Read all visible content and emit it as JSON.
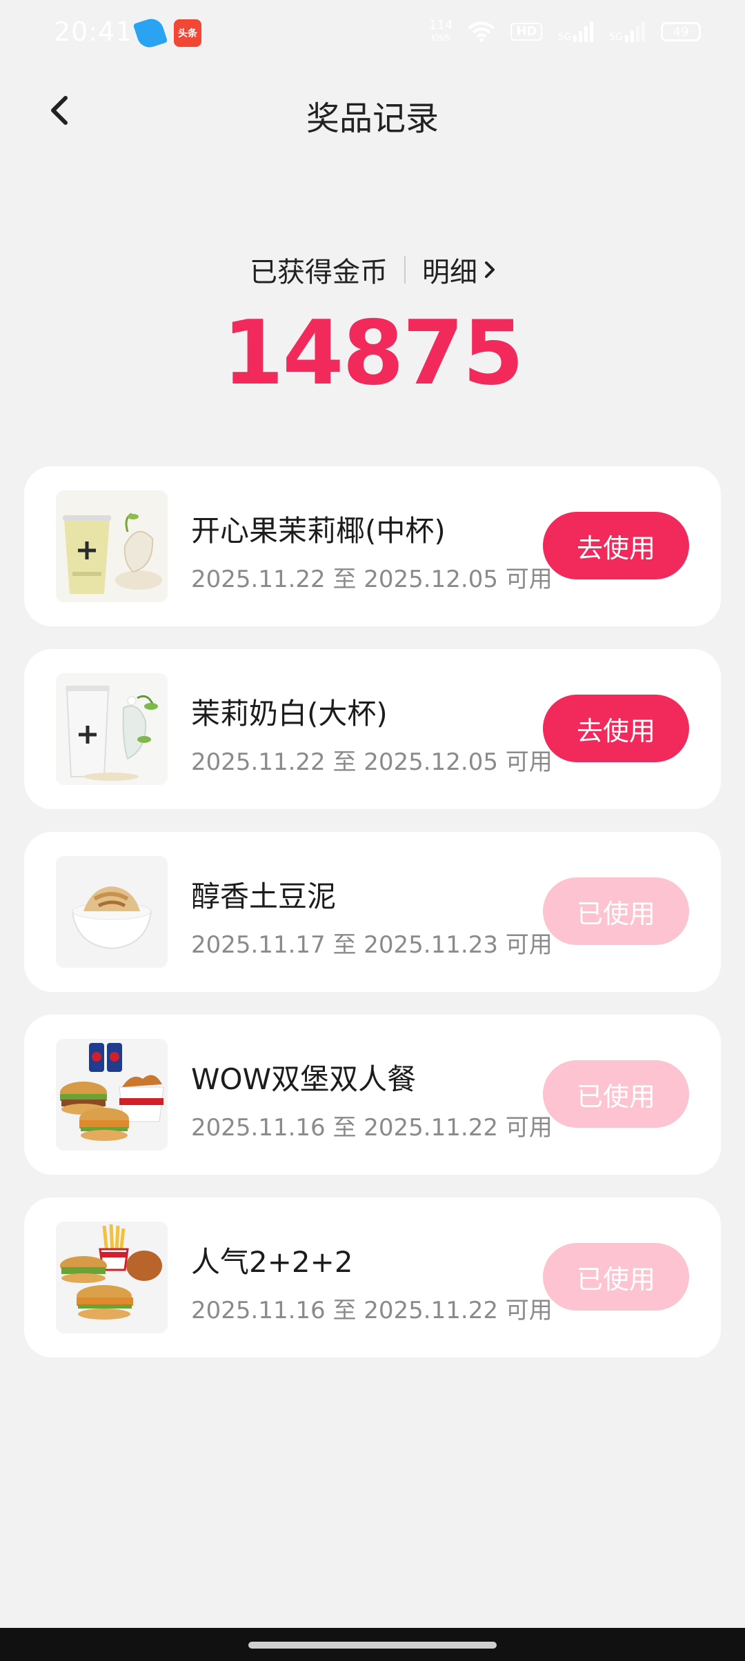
{
  "status_bar": {
    "time": "20:41",
    "app_icons": [
      "telegram-like-icon",
      "toutiao-icon"
    ],
    "toutiao_label": "头条",
    "net_speed_top": "114",
    "net_speed_bottom": "KB/S",
    "hd_label": "HD",
    "signal1": "5G",
    "signal2": "5G",
    "battery": "49"
  },
  "header": {
    "title": "奖品记录",
    "back_icon": "chevron-left-icon"
  },
  "coins": {
    "label": "已获得金币",
    "detail_label": "明细",
    "value": "14875"
  },
  "colors": {
    "accent": "#f2295b",
    "accent_disabled": "#fdc3d1",
    "background": "#f2f2f2"
  },
  "prizes": [
    {
      "name": "开心果茉莉椰(中杯)",
      "date": "2025.11.22 至 2025.12.05 可用",
      "action": "去使用",
      "status": "active",
      "image": "pistachio-jasmine-coconut-tea"
    },
    {
      "name": "茉莉奶白(大杯)",
      "date": "2025.11.22 至 2025.12.05 可用",
      "action": "去使用",
      "status": "active",
      "image": "jasmine-milk-tea"
    },
    {
      "name": "醇香土豆泥",
      "date": "2025.11.17 至 2025.11.23 可用",
      "action": "已使用",
      "status": "used",
      "image": "mashed-potato"
    },
    {
      "name": "WOW双堡双人餐",
      "date": "2025.11.16 至 2025.11.22 可用",
      "action": "已使用",
      "status": "used",
      "image": "double-burger-meal"
    },
    {
      "name": "人气2+2+2",
      "date": "2025.11.16 至 2025.11.22 可用",
      "action": "已使用",
      "status": "used",
      "image": "popular-combo"
    }
  ]
}
